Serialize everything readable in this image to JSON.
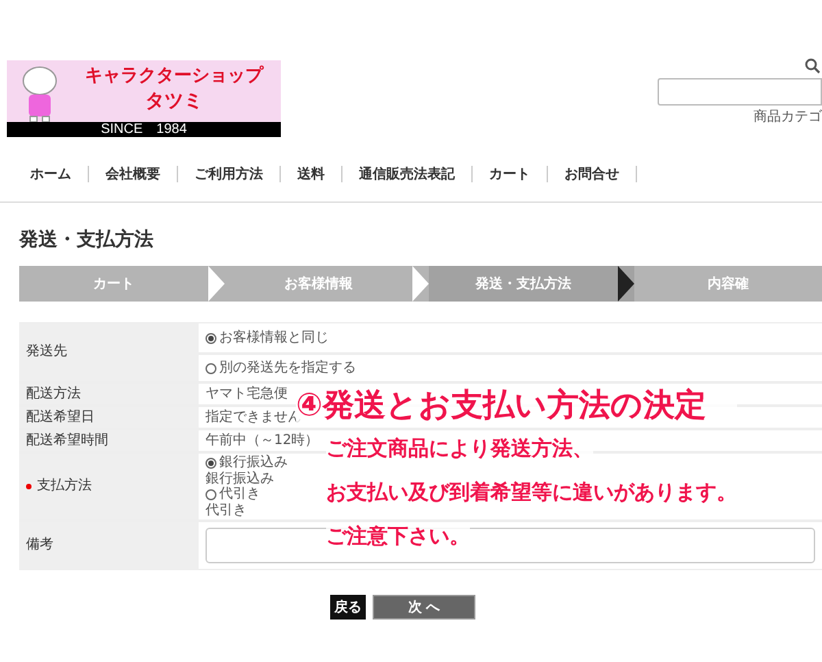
{
  "logo": {
    "title": "キャラクターショップ",
    "subtitle": "タツミ",
    "since": "SINCE　1984"
  },
  "search": {
    "category_label": "商品カテゴ"
  },
  "nav": [
    "ホーム",
    "会社概要",
    "ご利用方法",
    "送料",
    "通信販売法表記",
    "カート",
    "お問合せ"
  ],
  "heading": "発送・支払方法",
  "steps": [
    {
      "label": "カート",
      "selected": false
    },
    {
      "label": "お客様情報",
      "selected": false
    },
    {
      "label": "発送・支払方法",
      "selected": true
    },
    {
      "label": "内容確",
      "selected": false
    }
  ],
  "form": [
    {
      "label": "発送先",
      "kind": "radios",
      "required": false,
      "options": [
        {
          "label": "お客様情報と同じ",
          "selected": true
        },
        {
          "label": "別の発送先を指定する",
          "selected": false
        }
      ]
    },
    {
      "label": "配送方法",
      "kind": "text",
      "required": false,
      "value": "ヤマト宅急便"
    },
    {
      "label": "配送希望日",
      "kind": "text",
      "required": false,
      "value": "指定できません"
    },
    {
      "label": "配送希望時間",
      "kind": "text",
      "required": false,
      "value": "午前中（～12時）"
    },
    {
      "label": "支払方法",
      "kind": "payment",
      "required": true,
      "options": [
        {
          "label": "銀行振込み",
          "note": "銀行振込み",
          "selected": true
        },
        {
          "label": "代引き",
          "note": "代引き",
          "selected": false
        }
      ]
    },
    {
      "label": "備考",
      "kind": "textarea",
      "required": false
    }
  ],
  "annotation": {
    "title": "④発送とお支払い方法の決定",
    "lines": [
      "ご注文商品により発送方法、",
      "お支払い及び到着希望等に違いがあります。",
      "ご注意下さい。"
    ]
  },
  "buttons": [
    {
      "label": "戻る",
      "kind": "back"
    },
    {
      "label": "次 へ",
      "kind": "next"
    }
  ]
}
